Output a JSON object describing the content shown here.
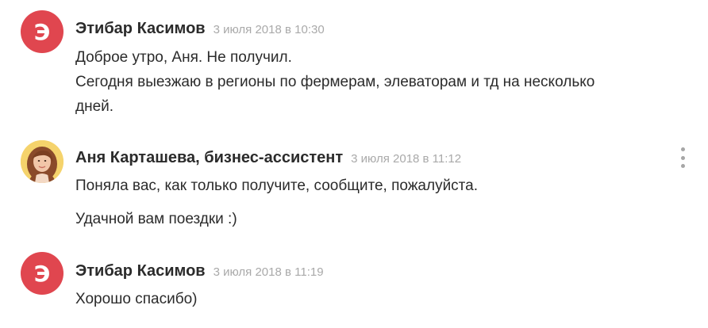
{
  "messages": [
    {
      "avatar_letter": "Э",
      "author": "Этибар Касимов",
      "time": "3 июля 2018 в 10:30",
      "lines": [
        "Доброе утро, Аня. Не получил.",
        "Сегодня выезжаю в регионы по фермерам, элеваторам и тд на несколько",
        "дней."
      ]
    },
    {
      "author": "Аня Карташева, бизнес-ассистент",
      "time": "3 июля 2018 в 11:12",
      "lines": [
        "Поняла вас, как только получите, сообщите, пожалуйста.",
        "Удачной вам поездки :)"
      ],
      "more_icon": "vertical-dots-icon"
    },
    {
      "avatar_letter": "Э",
      "author": "Этибар Касимов",
      "time": "3 июля 2018 в 11:19",
      "lines": [
        "Хорошо спасибо)"
      ]
    }
  ],
  "colors": {
    "avatar_red": "#e0464f",
    "author_text": "#2b2b2b",
    "timestamp_text": "#a9a9a9",
    "more_dots": "#a6a6a6"
  }
}
